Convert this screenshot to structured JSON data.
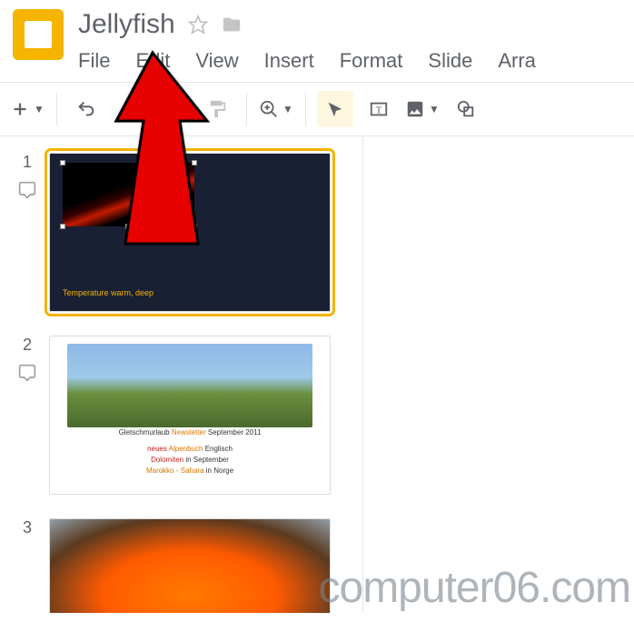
{
  "title": "Jellyfish",
  "menu": {
    "file": "File",
    "edit": "Edit",
    "view": "View",
    "insert": "Insert",
    "format": "Format",
    "slide": "Slide",
    "arrange": "Arra"
  },
  "slides": {
    "n1": "1",
    "n2": "2",
    "n3": "3",
    "s1_caption": "Temperature warm, deep",
    "s2_line1a": "Gletschmurlaub",
    "s2_line1b": "Newsletter",
    "s2_line1c": "September 2011",
    "s2_line2a": "neues",
    "s2_line2b": "Alpenbuch",
    "s2_line2c": "Englisch",
    "s2_line3a": "Dolomiten",
    "s2_line3b": "in September",
    "s2_line4a": "Marokko - Sahara",
    "s2_line4b": "in Norge"
  },
  "watermark": "computer06.com"
}
